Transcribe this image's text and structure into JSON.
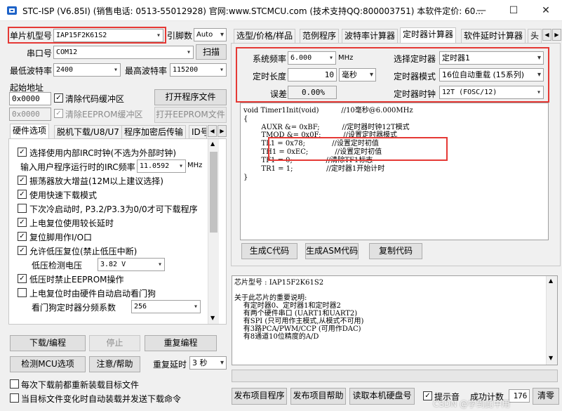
{
  "window": {
    "title": "STC-ISP (V6.85I) (销售电话: 0513-55012928) 官网:www.STCMCU.com (技术支持QQ:800003751) 本软件定价: 60...",
    "minimize": "—",
    "maximize": "☐",
    "close": "✕"
  },
  "left": {
    "mcu_type_label": "单片机型号",
    "mcu_type_value": "IAP15F2K61S2",
    "pin_label": "引脚数",
    "pin_value": "Auto",
    "port_label": "串口号",
    "port_value": "COM12",
    "scan_button": "扫描",
    "min_baud_label": "最低波特率",
    "min_baud_value": "2400",
    "max_baud_label": "最高波特率",
    "max_baud_value": "115200",
    "start_addr_label": "起始地址",
    "addr1_value": "0x0000",
    "clear_code_label": "清除代码缓冲区",
    "open_program_button": "打开程序文件",
    "addr2_value": "0x0000",
    "clear_eeprom_label": "清除EEPROM缓冲区",
    "open_eeprom_button": "打开EEPROM文件",
    "tabs": [
      "硬件选项",
      "脱机下载/U8/U7",
      "程序加密后传输",
      "ID号"
    ],
    "options": [
      {
        "label": "选择使用内部IRC时钟(不选为外部时钟)",
        "checked": true
      },
      {
        "label": "振荡器放大增益(12M以上建议选择)",
        "checked": true
      },
      {
        "label": "使用快速下载模式",
        "checked": true
      },
      {
        "label": "下次冷启动时, P3.2/P3.3为0/0才可下载程序",
        "checked": false
      },
      {
        "label": "上电复位使用较长延时",
        "checked": true
      },
      {
        "label": "复位脚用作I/O口",
        "checked": true
      },
      {
        "label": "允许低压复位(禁止低压中断)",
        "checked": true
      },
      {
        "label": "低压时禁止EEPROM操作",
        "checked": true
      },
      {
        "label": "上电复位时由硬件自动启动看门狗",
        "checked": false
      }
    ],
    "irc_label": "输入用户程序运行时的IRC频率",
    "irc_value": "11.0592",
    "irc_unit": "MHz",
    "lvd_label": "低压检测电压",
    "lvd_value": "3.82 V",
    "wdt_label": "看门狗定时器分频系数",
    "wdt_value": "256",
    "download_button": "下载/编程",
    "stop_button": "停止",
    "reprogram_button": "重复编程",
    "detect_button": "检测MCU选项",
    "help_button": "注意/帮助",
    "repeat_delay_label": "重复延时",
    "repeat_delay_value": "3 秒",
    "reload_each_label": "每次下载前都重新装载目标文件",
    "auto_reload_label": "当目标文件变化时自动装载并发送下载命令"
  },
  "right": {
    "tabs": [
      "选型/价格/样品",
      "范例程序",
      "波特率计算器",
      "定时器计算器",
      "软件延时计算器",
      "头"
    ],
    "sysfreq_label": "系统频率",
    "sysfreq_value": "6.000",
    "sysfreq_unit": "MHz",
    "select_timer_label": "选择定时器",
    "select_timer_value": "定时器1",
    "length_label": "定时长度",
    "length_value": "10",
    "length_unit": "毫秒",
    "mode_label": "定时器模式",
    "mode_value": "16位自动重载 (15系列)",
    "error_label": "误差",
    "error_value": "0.00%",
    "clock_label": "定时器时钟",
    "clock_value": "12T (FOSC/12)",
    "code_lines": [
      "void Timer1Init(void)          //10毫秒@6.000MHz",
      "{",
      "        AUXR &= 0xBF;          //定时器时钟12T模式",
      "        TMOD &= 0x0F;          //设置定时器模式",
      "        TL1 = 0x78;            //设置定时初值",
      "        TH1 = 0xEC;            //设置定时初值",
      "        TF1 = 0;               //清除TF1标志",
      "        TR1 = 1;               //定时器1开始计时",
      "}"
    ],
    "gen_c_button": "生成C代码",
    "gen_asm_button": "生成ASM代码",
    "copy_button": "复制代码",
    "info_lines": [
      "芯片型号 : IAP15F2K61S2",
      "",
      "关于此芯片的重要说明:",
      "    有定时器0、定时器1和定时器2",
      "    有两个硬件串口 (UART1和UART2)",
      "    有SPI (只可用作主模式,从模式不可用)",
      "    有3路PCA/PWM/CCP (可用作DAC)",
      "    有8通道10位精度的A/D"
    ],
    "publish_program_button": "发布项目程序",
    "publish_help_button": "发布项目帮助",
    "read_disk_button": "读取本机硬盘号",
    "tip_sound_label": "提示音",
    "success_count_label": "成功计数",
    "success_count_value": "176",
    "clear_button": "清零"
  },
  "watermark": "CSDN @学到此中用"
}
